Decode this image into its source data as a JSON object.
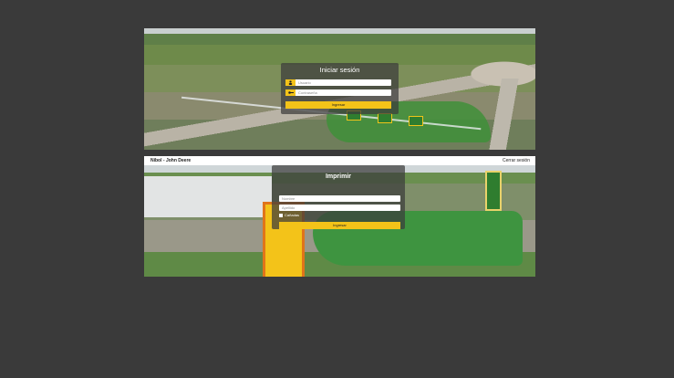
{
  "login": {
    "title": "Iniciar sesión",
    "username_placeholder": "Usuario",
    "password_placeholder": "Contraseña",
    "submit_label": "Ingresar"
  },
  "print": {
    "header": {
      "brand": "Nibol - John Deere",
      "logout_label": "Cerrar sesión"
    },
    "title": "Imprimir",
    "name_placeholder": "Nombre",
    "lastname_placeholder": "Apellido",
    "checkbox_label": "Cañadas",
    "submit_label": "Ingresar"
  },
  "icons": {
    "user": "user-icon",
    "key": "key-icon"
  },
  "colors": {
    "background": "#3a3a3a",
    "accent": "#f3c319",
    "card": "#3c3c3c"
  }
}
